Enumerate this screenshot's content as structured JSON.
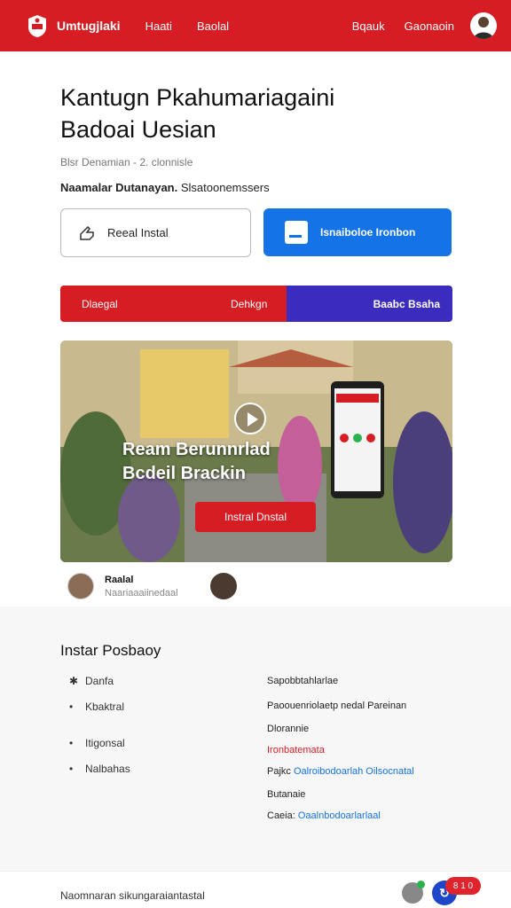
{
  "header": {
    "brand": "Umtugjlaki",
    "nav": [
      "Haati",
      "Baolal"
    ],
    "nav_right": [
      "Bqauk",
      "Gaonaoin"
    ],
    "accent": "#d71d24"
  },
  "main": {
    "title_line1": "Kantugn Pkahumariagaini",
    "title_line2": "Badoai Uesian",
    "meta": "Blsr Denamian - 2. clonnisle",
    "sub_bold": "Naamalar Dutanayan.",
    "sub_rest": "Slsatoonemssers",
    "btn_outline": "Reeal Instal",
    "btn_primary": "Isnaiboloe Ironbon",
    "seg_left": "Dlaegal",
    "seg_mid": "Dehkgn",
    "seg_right": "Baabc Bsaha",
    "hero_line1": "Ream Berunnrlad",
    "hero_line2": "Bcdeil Brackin",
    "hero_button": "Instral Dnstal",
    "person_name": "Raalal",
    "person_role": "Naariaaaiinedaal"
  },
  "section": {
    "title": "Instar Posbaoy",
    "list": [
      {
        "mark": "✱",
        "label": "Danfa"
      },
      {
        "mark": "•",
        "label": "Kbaktral"
      },
      {
        "mark": "•",
        "label": "Itigonsal"
      },
      {
        "mark": "•",
        "label": "Nalbahas"
      }
    ],
    "right": {
      "r1": "Sapobbtahlarlae",
      "r2": "Paoouenriolaetp nedal Pareinan",
      "r3": "Dlorannie",
      "r4": "Ironbatemata",
      "r5_label": "Pajkc",
      "r5_link": "Oalroibodoarlah Oilsocnatal",
      "r6": "Butanaie",
      "r7_label": "Caeia:",
      "r7_link": "Oaalnbodoarlarlaal"
    }
  },
  "footer": {
    "text": "Naomnaran sikungaraiantastal",
    "badge": "8 1 0"
  }
}
